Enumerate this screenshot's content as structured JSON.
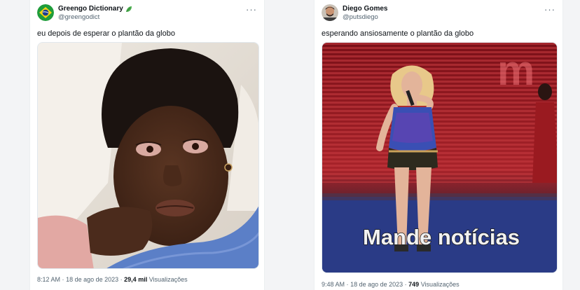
{
  "tweets": [
    {
      "name": "Greengo Dictionary",
      "badge": "leaf-emoji",
      "handle": "@greengodict",
      "text": "eu depois de esperar o plantão da globo",
      "time": "8:12 AM",
      "date": "18 de ago de 2023",
      "views": "29,4 mil",
      "views_label": "Visualizações",
      "separator": "·"
    },
    {
      "name": "Diego Gomes",
      "handle": "@putsdiego",
      "text": "esperando ansiosamente o plantão da globo",
      "time": "9:48 AM",
      "date": "18 de ago de 2023",
      "views": "749",
      "views_label": "Visualizações",
      "separator": "·",
      "caption": "Mande notícias"
    }
  ],
  "more_label": "···",
  "colors": {
    "text": "#0f1419",
    "muted": "#536471",
    "background": "#f3f4f6",
    "card": "#ffffff"
  }
}
